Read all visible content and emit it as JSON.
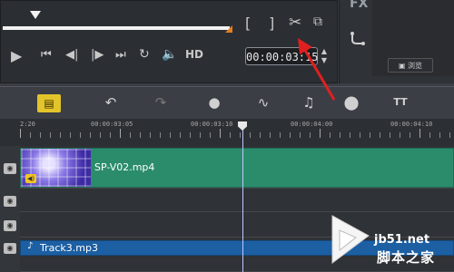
{
  "preview": {
    "bracket_in": "[",
    "bracket_out": "]",
    "hd_label": "HD",
    "timecode": "00:00:03:",
    "timecode_tail": "15",
    "scrub_progress": 0.5
  },
  "right_panel": {
    "fx_label": "FX",
    "browse_label": "浏览"
  },
  "ruler": {
    "ticks": [
      "2:20",
      "00:00:03:05",
      "00:00:03:10",
      "00:00:04:00",
      "00:00:04:10"
    ]
  },
  "tracks": {
    "video_clip_name": "SP-V02.mp4",
    "audio_clip_name": "Track3.mp3"
  },
  "watermark": {
    "site": "jb51.net",
    "name": "脚本之家"
  },
  "colors": {
    "video_clip": "#2b8c6c",
    "audio_clip": "#1c5fa3",
    "storyboard_button": "#e4c42b",
    "arrow": "#e02020"
  },
  "icons": [
    "play-icon",
    "jump-start-icon",
    "step-back-icon",
    "step-forward-icon",
    "jump-end-icon",
    "repeat-icon",
    "volume-icon",
    "scissors-icon",
    "copy-icon",
    "undo-icon",
    "redo-icon",
    "record-icon",
    "audio-wave-icon",
    "sound-mix-icon",
    "motion-icon",
    "title-icon"
  ]
}
